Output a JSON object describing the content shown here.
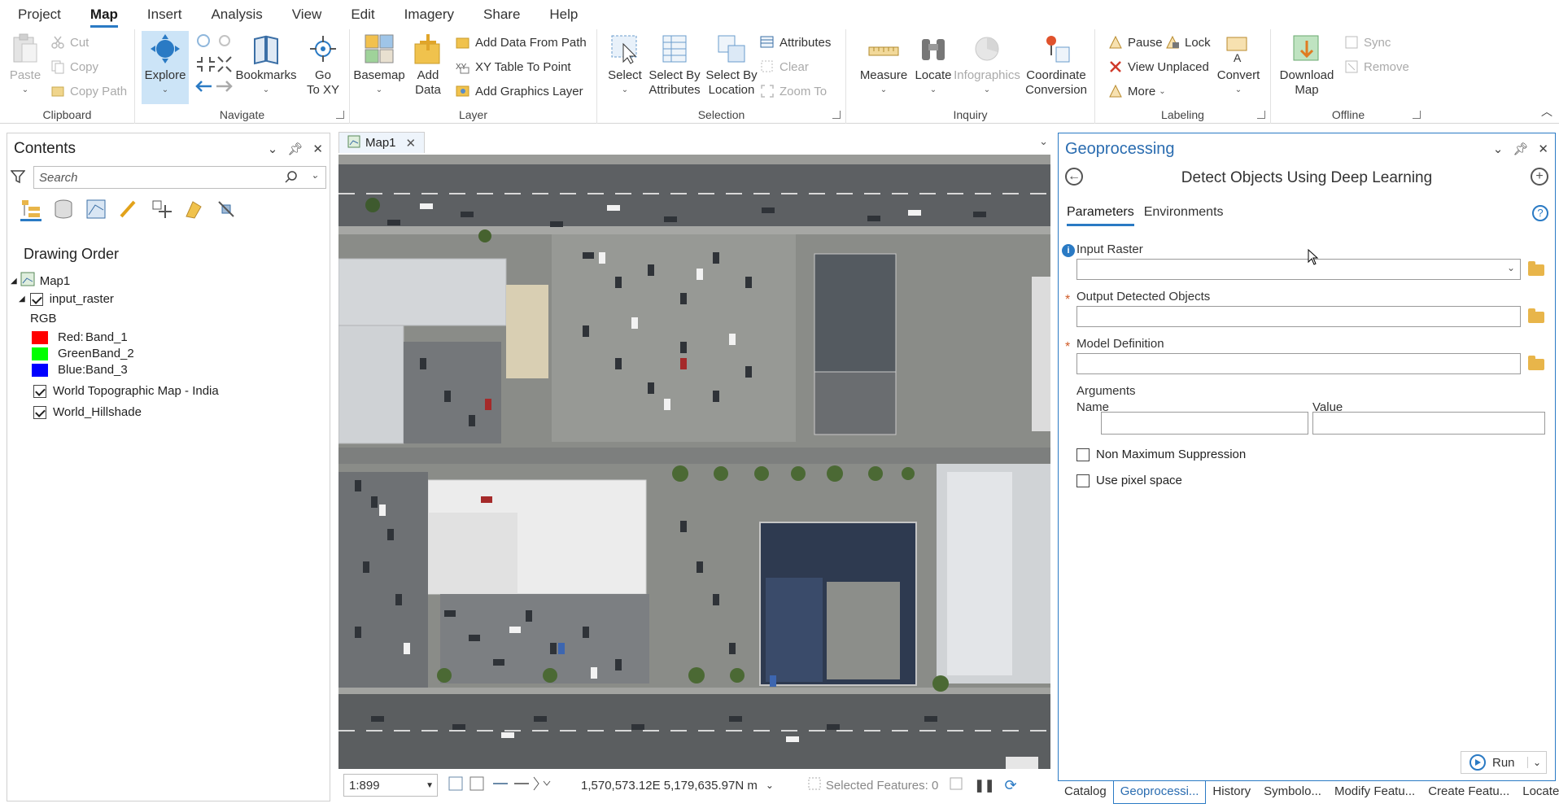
{
  "menu": {
    "tabs": [
      "Project",
      "Map",
      "Insert",
      "Analysis",
      "View",
      "Edit",
      "Imagery",
      "Share",
      "Help"
    ],
    "active_tab": "Map"
  },
  "ribbon": {
    "clipboard": {
      "label": "Clipboard",
      "paste": "Paste",
      "cut": "Cut",
      "copy": "Copy",
      "copy_path": "Copy Path"
    },
    "navigate": {
      "label": "Navigate",
      "explore": "Explore",
      "bookmarks": "Bookmarks",
      "go_to_xy_1": "Go",
      "go_to_xy_2": "To XY"
    },
    "layer": {
      "label": "Layer",
      "basemap": "Basemap",
      "add_data_1": "Add",
      "add_data_2": "Data",
      "add_data_from_path": "Add Data From Path",
      "xy_table_to_point": "XY Table To Point",
      "add_graphics_layer": "Add Graphics Layer"
    },
    "selection": {
      "label": "Selection",
      "select": "Select",
      "select_by_attributes_1": "Select By",
      "select_by_attributes_2": "Attributes",
      "select_by_location_1": "Select By",
      "select_by_location_2": "Location",
      "attributes": "Attributes",
      "clear": "Clear",
      "zoom_to": "Zoom To"
    },
    "inquiry": {
      "label": "Inquiry",
      "measure": "Measure",
      "locate": "Locate",
      "infographics": "Infographics",
      "coordinate_conversion_1": "Coordinate",
      "coordinate_conversion_2": "Conversion"
    },
    "labeling": {
      "label": "Labeling",
      "pause": "Pause",
      "lock": "Lock",
      "view_unplaced": "View Unplaced",
      "more": "More",
      "convert": "Convert"
    },
    "offline": {
      "label": "Offline",
      "download_map_1": "Download",
      "download_map_2": "Map",
      "sync": "Sync",
      "remove": "Remove"
    }
  },
  "contents": {
    "title": "Contents",
    "search_placeholder": "Search",
    "section": "Drawing Order",
    "map_name": "Map1",
    "layers": {
      "input_raster": "input_raster",
      "rgb": "RGB",
      "bands": [
        {
          "label": "Red:",
          "band": "Band_1",
          "color": "#ff0000"
        },
        {
          "label": "Green:",
          "band": "Band_2",
          "color": "#00ff00"
        },
        {
          "label": "Blue:",
          "band": "Band_3",
          "color": "#0000ff"
        }
      ],
      "topo": "World Topographic Map - India",
      "hillshade": "World_Hillshade"
    }
  },
  "map": {
    "tab": "Map1",
    "scale": "1:899",
    "coordinates": "1,570,573.12E 5,179,635.97N m",
    "selected_features": "Selected Features: 0"
  },
  "geoprocessing": {
    "title": "Geoprocessing",
    "tool": "Detect Objects Using Deep Learning",
    "tabs": {
      "parameters": "Parameters",
      "environments": "Environments"
    },
    "input_raster": "Input Raster",
    "output_detected_objects": "Output Detected Objects",
    "model_definition": "Model Definition",
    "arguments": "Arguments",
    "name": "Name",
    "value": "Value",
    "non_max_suppression": "Non Maximum Suppression",
    "use_pixel_space": "Use pixel space",
    "run": "Run"
  },
  "bottom_tabs": [
    "Catalog",
    "Geoprocessi...",
    "History",
    "Symbolo...",
    "Modify Featu...",
    "Create Featu...",
    "Locate"
  ],
  "colors": {
    "accent": "#2a7ac4",
    "required": "#d05c28",
    "folder": "#e8b54a"
  }
}
